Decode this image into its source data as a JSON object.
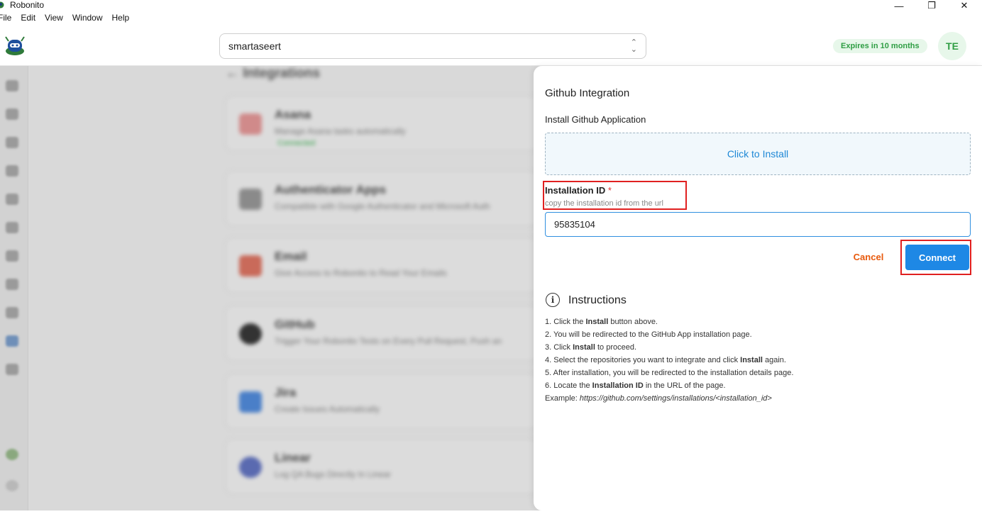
{
  "window": {
    "title": "Robonito",
    "minimize": "—",
    "maximize": "❐",
    "close": "✕"
  },
  "menu": [
    "File",
    "Edit",
    "View",
    "Window",
    "Help"
  ],
  "header": {
    "org_value": "smartaseert",
    "expires": "Expires in 10 months",
    "avatar_initials": "TE"
  },
  "background": {
    "heading": "Integrations",
    "cards": [
      {
        "title": "Asana",
        "desc": "Manage Asana tasks automatically",
        "status": "Connected"
      },
      {
        "title": "Authenticator Apps",
        "desc": "Compatible with Google Authenticator and Microsoft Auth"
      },
      {
        "title": "Email",
        "desc": "Give Access to Robonito to Read Your Emails"
      },
      {
        "title": "GitHub",
        "desc": "Trigger Your Robonito Tests on Every Pull Request, Push an"
      },
      {
        "title": "Jira",
        "desc": "Create Issues Automatically"
      },
      {
        "title": "Linear",
        "desc": "Log QA Bugs Directly In Linear"
      }
    ]
  },
  "drawer": {
    "title": "Github Integration",
    "install_section": "Install Github Application",
    "install_button": "Click to Install",
    "field_label": "Installation ID",
    "required_mark": "*",
    "field_hint": "copy the installation id from the url",
    "field_value": "95835104",
    "cancel": "Cancel",
    "connect": "Connect",
    "instructions_title": "Instructions",
    "instructions": {
      "s1a": "1. Click the ",
      "s1b": "Install",
      "s1c": " button above.",
      "s2": "2. You will be redirected to the GitHub App installation page.",
      "s3a": "3. Click ",
      "s3b": "Install",
      "s3c": " to proceed.",
      "s4a": "4. Select the repositories you want to integrate and click ",
      "s4b": "Install",
      "s4c": " again.",
      "s5": "5. After installation, you will be redirected to the installation details page.",
      "s6a": "6. Locate the ",
      "s6b": "Installation ID",
      "s6c": " in the URL of the page.",
      "ex_label": "Example: ",
      "ex_url": "https://github.com/settings/installations/<installation_id>"
    }
  },
  "colors": {
    "accent": "#1e88e5",
    "success": "#2f9e44",
    "cancel": "#e8590c",
    "highlight": "#e02020"
  }
}
